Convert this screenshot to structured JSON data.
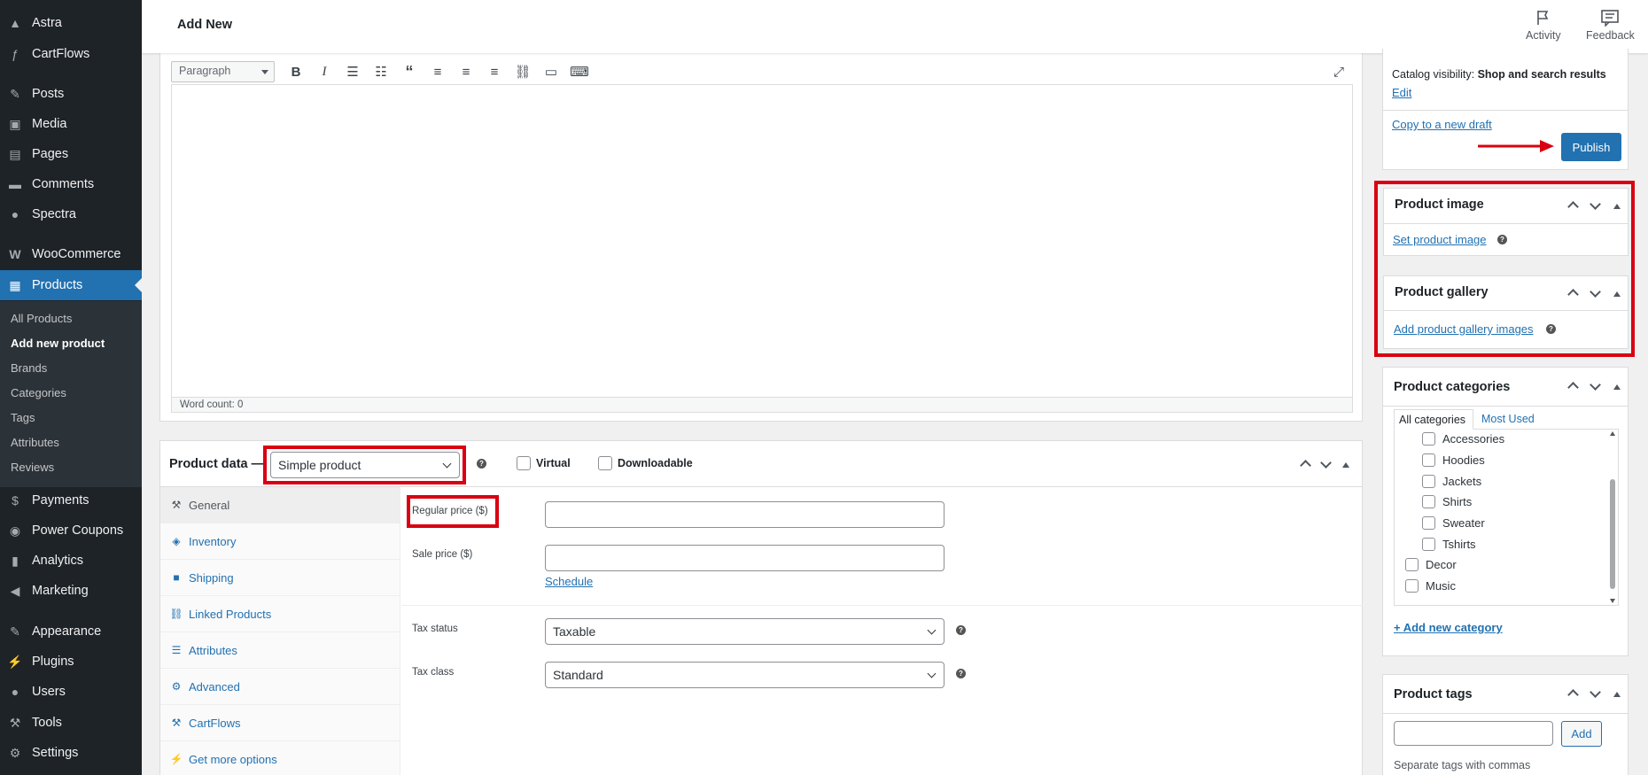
{
  "menu": {
    "top": [
      "Astra",
      "CartFlows"
    ],
    "main": [
      "Posts",
      "Media",
      "Pages",
      "Comments",
      "Spectra"
    ],
    "woocommerce": "WooCommerce",
    "products": "Products",
    "submenu": [
      "All Products",
      "Add new product",
      "Brands",
      "Categories",
      "Tags",
      "Attributes",
      "Reviews"
    ],
    "more": [
      "Payments",
      "Power Coupons",
      "Analytics",
      "Marketing"
    ],
    "bottom": [
      "Appearance",
      "Plugins",
      "Users",
      "Tools",
      "Settings"
    ]
  },
  "header": {
    "title": "Add New",
    "activity": "Activity",
    "feedback": "Feedback"
  },
  "editor": {
    "format": "Paragraph",
    "word_count": "Word count: 0"
  },
  "product_data": {
    "label": "Product data —",
    "type": "Simple product",
    "virtual": "Virtual",
    "downloadable": "Downloadable",
    "tabs": [
      "General",
      "Inventory",
      "Shipping",
      "Linked Products",
      "Attributes",
      "Advanced",
      "CartFlows",
      "Get more options"
    ],
    "regular_price_label": "Regular price ($)",
    "sale_price_label": "Sale price ($)",
    "schedule": "Schedule",
    "tax_status_label": "Tax status",
    "tax_status": "Taxable",
    "tax_class_label": "Tax class",
    "tax_class": "Standard"
  },
  "publish": {
    "visibility_label": "Catalog visibility:",
    "visibility_value": "Shop and search results",
    "edit": "Edit",
    "copy": "Copy to a new draft",
    "button": "Publish"
  },
  "product_image": {
    "title": "Product image",
    "link": "Set product image"
  },
  "product_gallery": {
    "title": "Product gallery",
    "link": "Add product gallery images"
  },
  "categories": {
    "title": "Product categories",
    "tab_all": "All categories",
    "tab_used": "Most Used",
    "children": [
      "Accessories",
      "Hoodies",
      "Jackets",
      "Shirts",
      "Sweater",
      "Tshirts"
    ],
    "top": [
      "Decor",
      "Music"
    ],
    "add_new": "+ Add new category"
  },
  "tags": {
    "title": "Product tags",
    "add": "Add",
    "hint": "Separate tags with commas"
  },
  "colors": {
    "accent": "#2271b1",
    "highlight": "#d90011",
    "menu_bg": "#1d2327"
  }
}
